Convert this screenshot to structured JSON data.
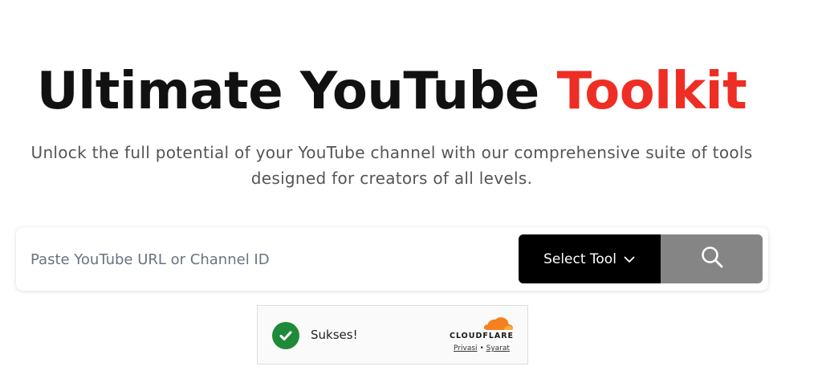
{
  "hero": {
    "title_main": "Ultimate YouTube",
    "title_accent": "Toolkit",
    "subtitle_line1": "Unlock the full potential of your YouTube channel with our comprehensive suite of tools",
    "subtitle_line2": "designed for creators of all levels."
  },
  "search": {
    "placeholder": "Paste YouTube URL or Channel ID",
    "value": "",
    "tool_select_label": "Select Tool",
    "search_icon": "search-icon",
    "dropdown_icon": "chevron-down-icon"
  },
  "captcha": {
    "status": "Sukses!",
    "status_icon": "check-circle-icon",
    "brand": "CLOUDFLARE",
    "privacy_link": "Privasi",
    "separator": "•",
    "terms_link": "Syarat"
  },
  "colors": {
    "accent": "#ee2e24",
    "title": "#111111",
    "subtitle": "#555555",
    "select_bg": "#000000",
    "search_btn_bg": "#858585",
    "success": "#1f8a3a",
    "cloudflare_orange": "#f48120"
  }
}
